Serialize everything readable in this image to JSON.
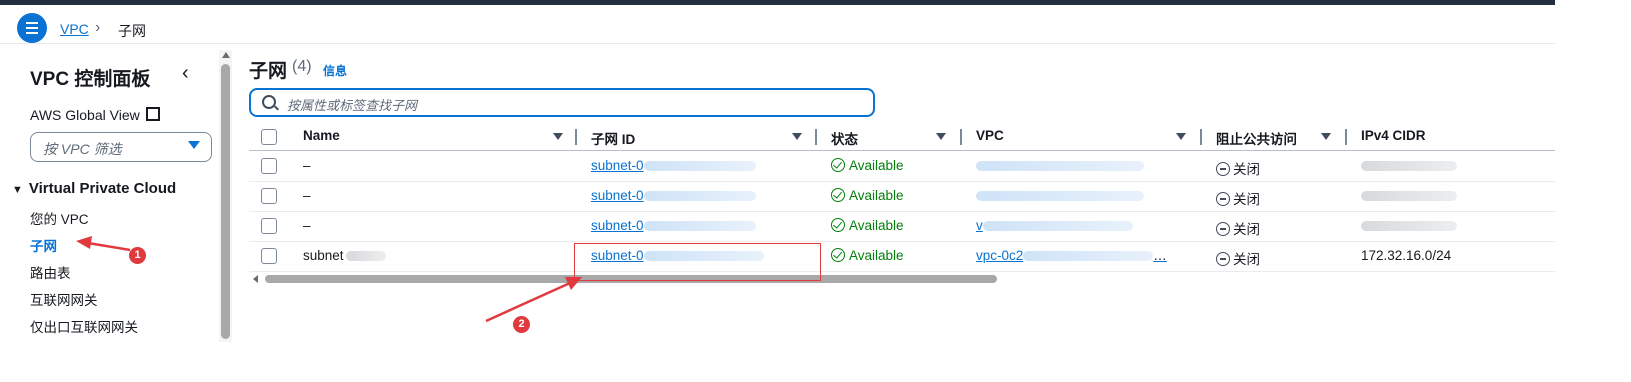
{
  "breadcrumb": {
    "root": "VPC",
    "separator": "›",
    "current": "子网"
  },
  "sidebar": {
    "title": "VPC 控制面板",
    "global_view": "AWS Global View",
    "filter_placeholder": "按 VPC 筛选",
    "section": "Virtual Private Cloud",
    "items": [
      {
        "label": "您的 VPC",
        "active": false
      },
      {
        "label": "子网",
        "active": true
      },
      {
        "label": "路由表",
        "active": false
      },
      {
        "label": "互联网网关",
        "active": false
      },
      {
        "label": "仅出口互联网网关",
        "active": false
      }
    ]
  },
  "main": {
    "title": "子网",
    "count": "(4)",
    "info": "信息",
    "search_placeholder": "按属性或标签查找子网",
    "columns": [
      "Name",
      "子网 ID",
      "状态",
      "VPC",
      "阻止公共访问",
      "IPv4 CIDR"
    ],
    "rows": [
      {
        "name": "–",
        "subnet_id": "subnet-0",
        "status": "Available",
        "vpc": "",
        "block": "关闭",
        "cidr": ""
      },
      {
        "name": "–",
        "subnet_id": "subnet-0",
        "status": "Available",
        "vpc": "",
        "block": "关闭",
        "cidr": ""
      },
      {
        "name": "–",
        "subnet_id": "subnet-0",
        "status": "Available",
        "vpc": "v",
        "block": "关闭",
        "cidr": ""
      },
      {
        "name": "subnet",
        "subnet_id": "subnet-0",
        "status": "Available",
        "vpc": "vpc-0c2",
        "vpc_suffix": "…",
        "block": "关闭",
        "cidr": "172.32.16.0/24"
      }
    ]
  },
  "annotations": {
    "badge1": "1",
    "badge2": "2",
    "color": "#e0393e"
  },
  "colors": {
    "accent": "#0972d3",
    "success": "#037f0c",
    "header": "#232f3e"
  }
}
